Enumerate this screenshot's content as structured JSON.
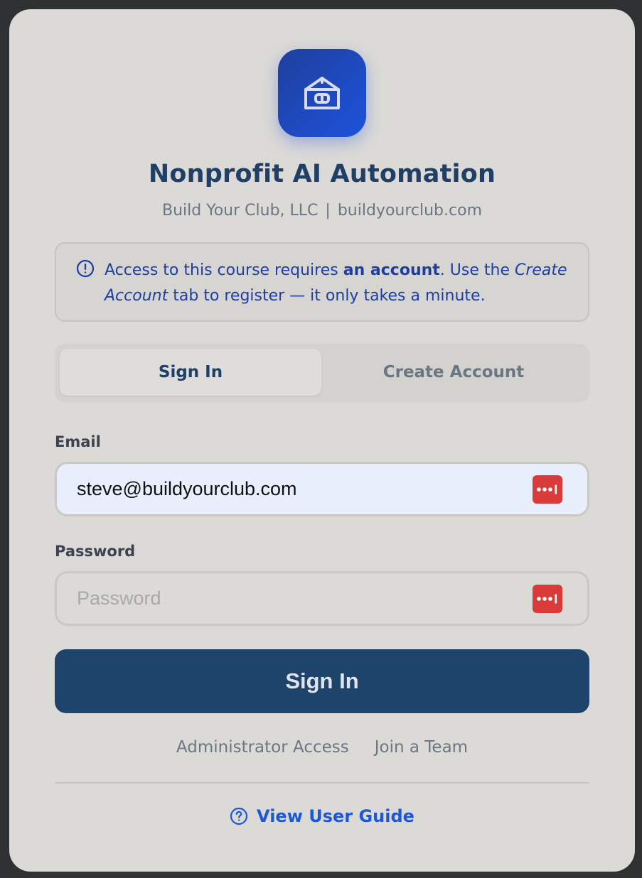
{
  "app": {
    "title": "Nonprofit AI Automation",
    "company": "Build Your Club, LLC",
    "separator": "|",
    "website": "buildyourclub.com",
    "logo_icon": "box-store-icon"
  },
  "notice": {
    "icon": "info-circle-icon",
    "text_before": "Access to this course requires ",
    "bold": "an account",
    "text_middle": ". Use the ",
    "italic": "Create Account",
    "text_after": " tab to register — it only takes a minute."
  },
  "tabs": [
    {
      "label": "Sign In",
      "active": true
    },
    {
      "label": "Create Account",
      "active": false
    }
  ],
  "form": {
    "email_label": "Email",
    "email_value": "steve@buildyourclub.com",
    "password_label": "Password",
    "password_placeholder": "Password",
    "password_manager_icon": "password-manager-icon",
    "submit_label": "Sign In"
  },
  "links": {
    "admin": "Administrator Access",
    "join": "Join a Team"
  },
  "guide": {
    "label": "View User Guide",
    "icon": "question-circle-icon"
  },
  "colors": {
    "card_bg": "#dbdad7",
    "brand_blue": "#1d53dc",
    "title_navy": "#1f3f66",
    "button_navy": "#1f446b",
    "link_blue": "#1d57d6",
    "password_manager_red": "#d93b3b"
  }
}
